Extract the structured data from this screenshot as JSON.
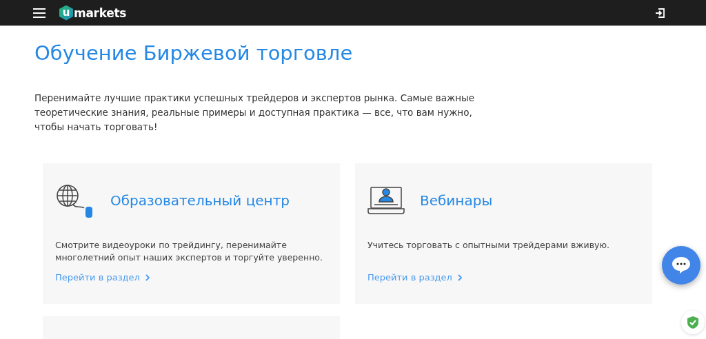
{
  "header": {
    "logo_mark": "u",
    "logo_text": "markets"
  },
  "title": "Обучение Биржевой торговле",
  "intro": "Перенимайте лучшие практики успешных трейдеров и экспертов рынка. Самые важные теоретические знания, реальные примеры и доступная практика — все, что вам нужно, чтобы начать торговать!",
  "cards": [
    {
      "kind": "globe",
      "title": "Образовательный центр",
      "text": "Смотрите видеоуроки по трейдингу, перенимайте многолетний опыт наших экспертов и торгуйте уверенно.",
      "link": "Перейти в раздел"
    },
    {
      "kind": "laptop",
      "title": "Вебинары",
      "text": "Учитесь торговать с опытными трейдерами вживую.",
      "link": "Перейти в раздел"
    },
    {
      "kind": "empty"
    }
  ]
}
